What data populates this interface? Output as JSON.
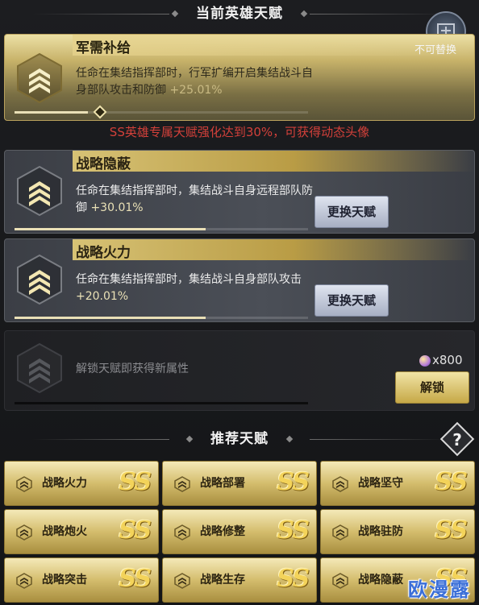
{
  "current_section": {
    "title": "当前英雄天赋"
  },
  "talents": [
    {
      "name": "军需补给",
      "desc": "任命在集结指挥部时，行军扩编开启集结战斗自身部队攻击和防御",
      "value": "+25.01%",
      "tag": "不可替换",
      "progress": 0.25
    },
    {
      "name": "战略隐蔽",
      "desc": "任命在集结指挥部时，集结战斗自身远程部队防御",
      "value": "+30.01%",
      "button": "更换天赋",
      "progress": 0.65
    },
    {
      "name": "战略火力",
      "desc": "任命在集结指挥部时，集结战斗自身部队攻击",
      "value": "+20.01%",
      "button": "更换天赋",
      "progress": 0.65
    }
  ],
  "ss_notice": "SS英雄专属天赋强化达到30%，可获得动态头像",
  "locked_slot": {
    "desc": "解锁天赋即获得新属性",
    "cost": "x800",
    "button": "解锁"
  },
  "recommended_section": {
    "title": "推荐天赋",
    "help": "?"
  },
  "recommended": [
    {
      "name": "战略火力",
      "grade": "SS"
    },
    {
      "name": "战略部署",
      "grade": "SS"
    },
    {
      "name": "战略坚守",
      "grade": "SS"
    },
    {
      "name": "战略炮火",
      "grade": "SS"
    },
    {
      "name": "战略修整",
      "grade": "SS"
    },
    {
      "name": "战略驻防",
      "grade": "SS"
    },
    {
      "name": "战略突击",
      "grade": "SS"
    },
    {
      "name": "战略生存",
      "grade": "SS"
    },
    {
      "name": "战略隐蔽",
      "grade": "SS"
    }
  ],
  "watermark": "欧漫露",
  "colors": {
    "gold": "#d7c275",
    "notice_red": "#d2403a",
    "panel": "#151618"
  }
}
